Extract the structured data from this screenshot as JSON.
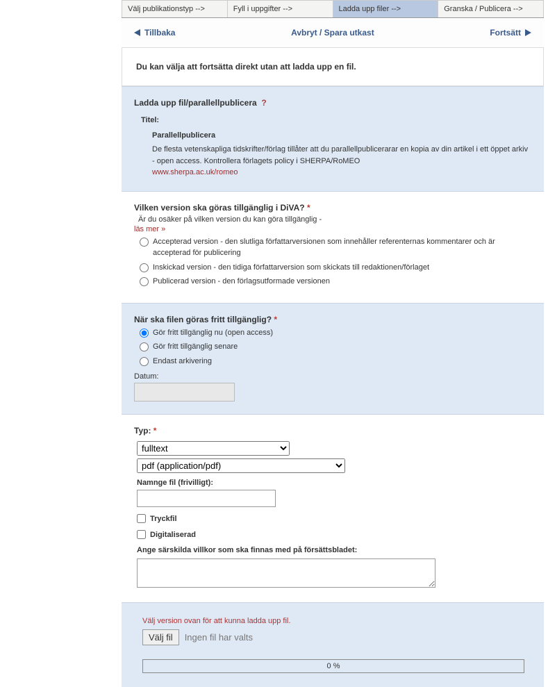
{
  "tabs": [
    "Välj publikationstyp -->",
    "Fyll i uppgifter -->",
    "Ladda upp filer -->",
    "Granska / Publicera -->"
  ],
  "nav": {
    "back": "Tillbaka",
    "center": "Avbryt / Spara utkast",
    "forward": "Fortsätt"
  },
  "info": "Du kan välja att fortsätta direkt utan att ladda upp en fil.",
  "upload": {
    "title": "Ladda upp fil/parallellpublicera",
    "help": "?",
    "titel_label": "Titel:",
    "para_head": "Parallellpublicera",
    "para_text": "De flesta vetenskapliga tidskrifter/förlag tillåter att du parallellpublicerarar en kopia av din artikel i ett öppet arkiv - open access. Kontrollera förlagets policy i SHERPA/RoMEO",
    "para_link": "www.sherpa.ac.uk/romeo"
  },
  "version": {
    "q": "Vilken version ska göras tillgänglig i DiVA?",
    "note": "Är du osäker på vilken version du kan göra tillgänglig -",
    "readmore": "läs mer »",
    "opt1": "Accepterad version - den slutliga författarversionen som innehåller referenternas kommentarer och är accepterad för publicering",
    "opt2": "Inskickad version - den tidiga författarversion som skickats till redaktionen/förlaget",
    "opt3": "Publicerad version - den förlagsutformade versionen"
  },
  "avail": {
    "q": "När ska filen göras fritt tillgänglig?",
    "opt1": "Gör fritt tillgänglig nu (open access)",
    "opt2": "Gör fritt tillgänglig senare",
    "opt3": "Endast arkivering",
    "datum": "Datum:"
  },
  "type": {
    "label": "Typ:",
    "sel1": "fulltext",
    "sel2": "pdf (application/pdf)",
    "name_label": "Namnge fil (frivilligt):",
    "chk1": "Tryckfil",
    "chk2": "Digitaliserad",
    "conditions_label": "Ange särskilda villkor som ska finnas med på försättsbladet:"
  },
  "file": {
    "err": "Välj version ovan för att kunna ladda upp fil.",
    "btn": "Välj fil",
    "none": "Ingen fil har valts",
    "progress": "0 %"
  }
}
